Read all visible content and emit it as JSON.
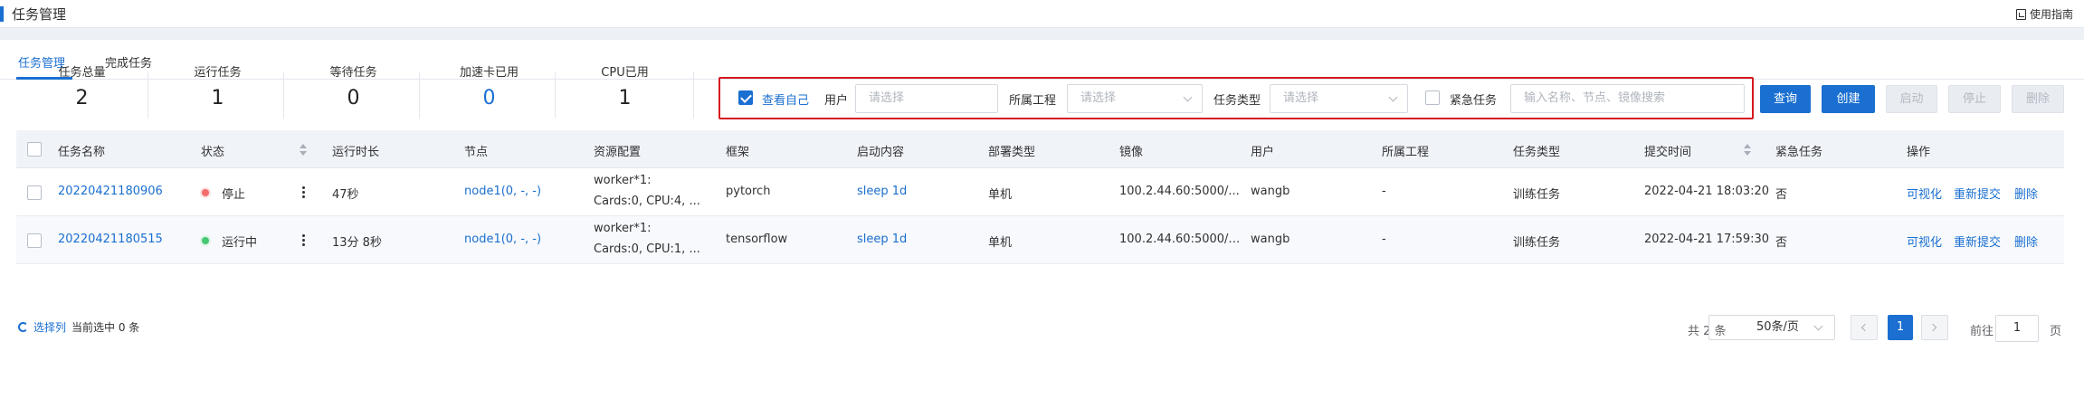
{
  "header": {
    "title": "任务管理",
    "guide": "使用指南"
  },
  "tabs": [
    {
      "label": "任务管理"
    },
    {
      "label": "完成任务"
    }
  ],
  "stats": [
    {
      "label": "任务总量",
      "value": "2"
    },
    {
      "label": "运行任务",
      "value": "1"
    },
    {
      "label": "等待任务",
      "value": "0"
    },
    {
      "label": "加速卡已用",
      "value": "0"
    },
    {
      "label": "CPU已用",
      "value": "1"
    }
  ],
  "filters": {
    "view_mine": "查看自己",
    "user_label": "用户",
    "user_placeholder": "请选择",
    "project_label": "所属工程",
    "project_placeholder": "请选择",
    "type_label": "任务类型",
    "type_placeholder": "请选择",
    "urgent_label": "紧急任务",
    "search_placeholder": "输入名称、节点、镜像搜索"
  },
  "buttons": {
    "query": "查询",
    "create": "创建",
    "start": "启动",
    "stop": "停止",
    "delete": "删除"
  },
  "columns": [
    "任务名称",
    "状态",
    "运行时长",
    "节点",
    "资源配置",
    "框架",
    "启动内容",
    "部署类型",
    "镜像",
    "用户",
    "所属工程",
    "任务类型",
    "提交时间",
    "紧急任务",
    "操作"
  ],
  "rows": [
    {
      "name": "20220421180906",
      "status": "停止",
      "status_color": "#f56c6c",
      "duration": "47秒",
      "node": "node1(0, -, -)",
      "res1": "worker*1:",
      "res2": "Cards:0, CPU:4, ...",
      "framework": "pytorch",
      "start": "sleep 1d",
      "deploy": "单机",
      "image": "100.2.44.60:5000/...",
      "user": "wangb",
      "project": "-",
      "type": "训练任务",
      "submitted": "2022-04-21 18:03:20",
      "urgent": "否",
      "actions": [
        "可视化",
        "重新提交",
        "删除"
      ]
    },
    {
      "name": "20220421180515",
      "status": "运行中",
      "status_color": "#48c774",
      "duration": "13分 8秒",
      "node": "node1(0, -, -)",
      "res1": "worker*1:",
      "res2": "Cards:0, CPU:1, ...",
      "framework": "tensorflow",
      "start": "sleep 1d",
      "deploy": "单机",
      "image": "100.2.44.60:5000/t...",
      "user": "wangb",
      "project": "-",
      "type": "训练任务",
      "submitted": "2022-04-21 17:59:30",
      "urgent": "否",
      "actions": [
        "可视化",
        "重新提交",
        "删除"
      ]
    }
  ],
  "footer": {
    "select_columns": "选择列",
    "selected": "当前选中 0 条",
    "total": "共 2 条",
    "page_size": "50条/页",
    "current_page": "1",
    "goto_before": "前往",
    "goto_value": "1",
    "goto_after": "页"
  }
}
